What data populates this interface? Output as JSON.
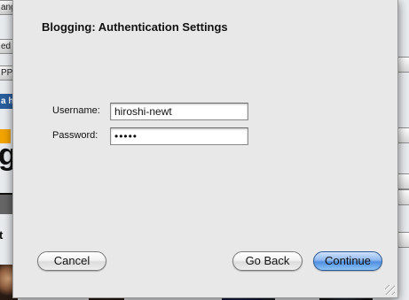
{
  "background": {
    "left_tabs": [
      "ang",
      "ed",
      "PPL",
      "a hi"
    ],
    "big_text": "g",
    "small_text": "t"
  },
  "sheet": {
    "title": "Blogging: Authentication Settings",
    "username_label": "Username:",
    "username_value": "hiroshi-newt",
    "password_label": "Password:",
    "password_value": "•••••",
    "buttons": {
      "cancel": "Cancel",
      "go_back": "Go Back",
      "continue": "Continue"
    }
  },
  "colors": {
    "default_button": "#4f8fe0",
    "sheet_background": "#e8e8e8"
  }
}
